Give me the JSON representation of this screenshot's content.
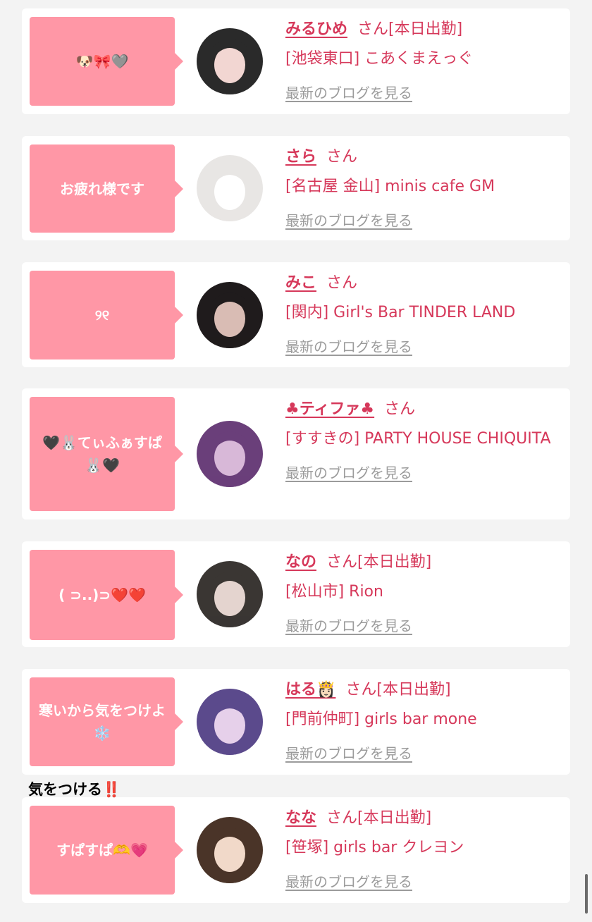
{
  "cards": [
    {
      "message": "🐶🎀🩶",
      "name": "みるひめ",
      "suffix": "さん[本日出勤]",
      "shop": "[池袋東口] こあくまえっぐ",
      "blog_link": "最新のブログを見る",
      "avatar_colors": [
        "#2a2a2a",
        "#f2d6d2"
      ]
    },
    {
      "message": "お疲れ様です",
      "name": "さら",
      "suffix": "さん",
      "shop": "[名古屋 金山] minis cafe GM",
      "blog_link": "最新のブログを見る",
      "avatar_colors": [
        "#e8e6e4",
        "#ffffff"
      ]
    },
    {
      "message": "୨୧",
      "name": "みこ",
      "suffix": "さん",
      "shop": "[関内] Girl's Bar TINDER LAND",
      "blog_link": "最新のブログを見る",
      "avatar_colors": [
        "#1f1b1c",
        "#d9bcb4"
      ]
    },
    {
      "message": "🖤🐰てぃふぁすぱ🐰🖤",
      "name": "♣ティファ♣",
      "suffix": "さん",
      "shop": "[すすきの] PARTY HOUSE CHIQUITA",
      "blog_link": "最新のブログを見る",
      "avatar_colors": [
        "#6a3f7a",
        "#d8b8d8"
      ]
    },
    {
      "message": "( ⊃..)⊃❤️❤️",
      "name": "なの",
      "suffix": "さん[本日出勤]",
      "shop": "[松山市] Rion",
      "blog_link": "最新のブログを見る",
      "avatar_colors": [
        "#3a3633",
        "#e4d4cf"
      ]
    },
    {
      "message": "寒いから気をつけよ❄️",
      "name": "はる👸🏻",
      "suffix": "さん[本日出勤]",
      "shop": "[門前仲町] girls bar mone",
      "blog_link": "最新のブログを見る",
      "avatar_colors": [
        "#5b4a8c",
        "#e6d0ea"
      ]
    },
    {
      "message": "すぱすぱ🫶💗",
      "name": "なな",
      "suffix": "さん[本日出勤]",
      "shop": "[笹塚] girls bar クレヨン",
      "blog_link": "最新のブログを見る",
      "avatar_colors": [
        "#4a3428",
        "#f1d9c9"
      ]
    }
  ],
  "between_label": "気をつける‼️",
  "colors": {
    "accent": "#d6385a",
    "bubble": "#ff97a6",
    "link_gray": "#9b9b9b",
    "page_bg": "#f3f3f3"
  }
}
